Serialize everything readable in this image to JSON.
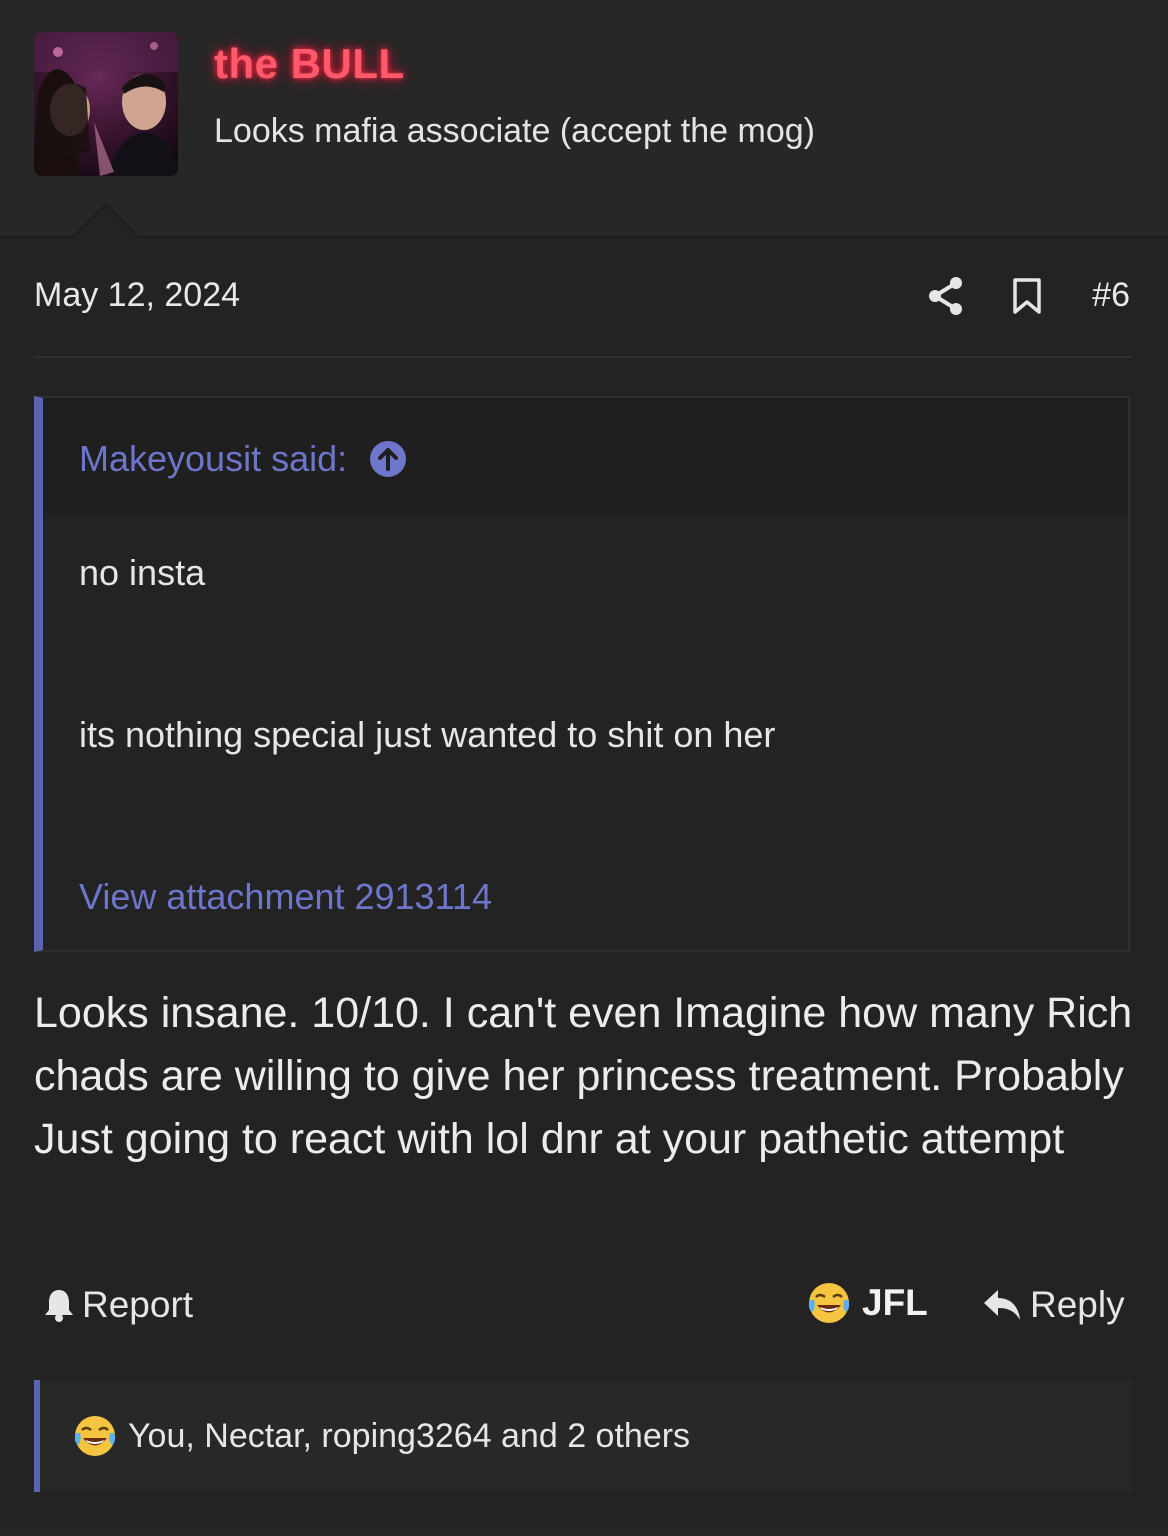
{
  "user": {
    "name": "the BULL",
    "title": "Looks mafia associate (accept the mog)"
  },
  "post": {
    "date": "May 12, 2024",
    "number": "#6",
    "quote": {
      "author": "Makeyousit said:",
      "line1": "no insta",
      "line2": "its nothing special just wanted to shit on her",
      "attachment": "View attachment 2913114"
    },
    "body": "Looks insane. 10/10. I can't even Imagine how many Rich chads are willing to give her princess treatment. Probably Just going to react with lol dnr at your pathetic attempt"
  },
  "actions": {
    "report": "Report",
    "reaction": "JFL",
    "reply": "Reply"
  },
  "reactions": {
    "summary": "You, Nectar, roping3264 and 2 others"
  },
  "colors": {
    "background": "#232323",
    "accent": "#5c63b5",
    "link": "#6e76cc",
    "username": "#ff5a6b"
  },
  "icons": [
    "share-icon",
    "bookmark-icon",
    "arrow-up-circle-icon",
    "bell-icon",
    "laughing-crying-emoji-icon",
    "reply-arrow-icon"
  ]
}
